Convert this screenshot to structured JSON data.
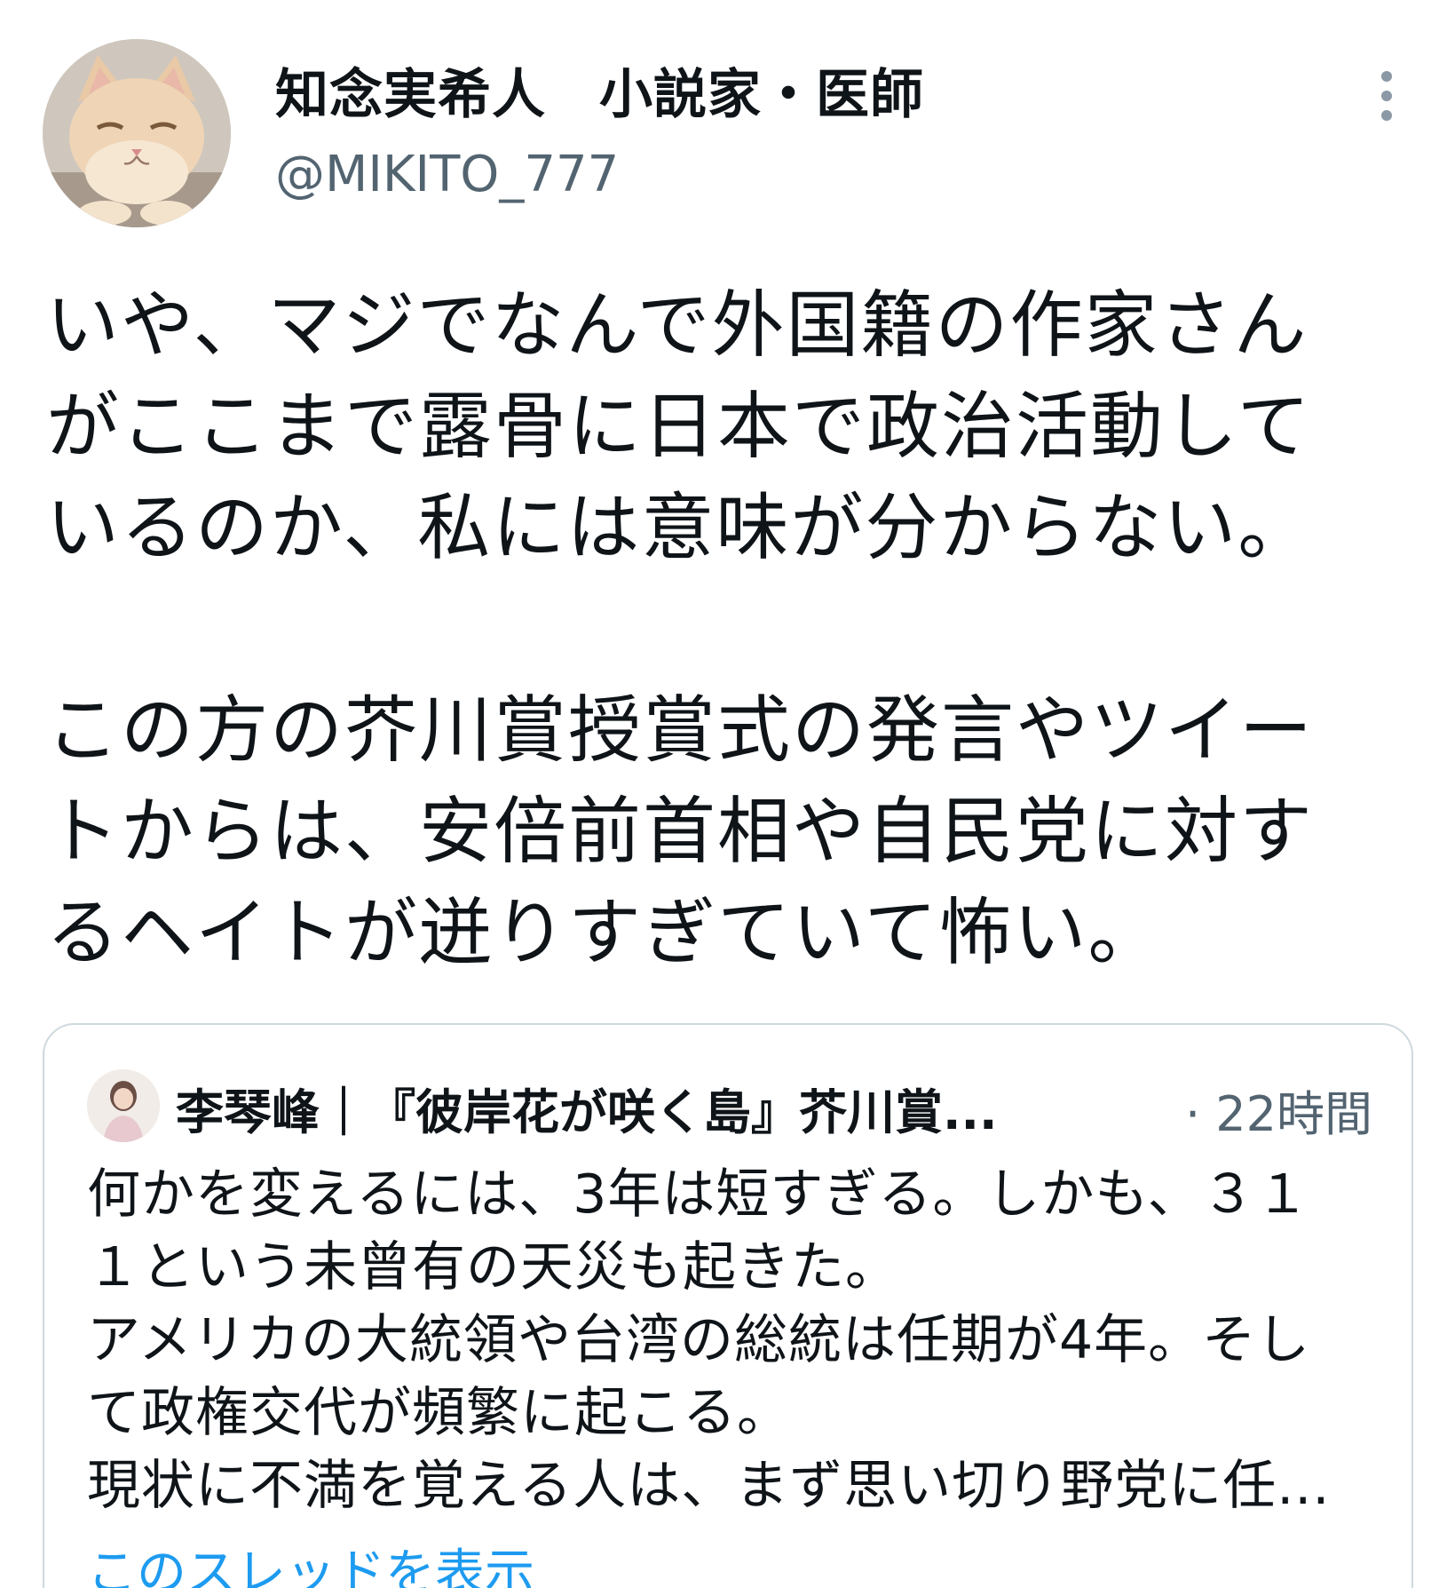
{
  "author": {
    "display_name": "知念実希人",
    "bio_tag": "小説家・医師",
    "handle": "@MIKITO_777",
    "avatar_icon": "cat-avatar-icon"
  },
  "header": {
    "more_icon": "more-vertical-icon",
    "more_color": "#8b98a5"
  },
  "tweet": {
    "lines": [
      "いや、マジでなんで外国籍の作家さん",
      "がここまで露骨に日本で政治活動して",
      "いるのか、私には意味が分からない。",
      "",
      "この方の芥川賞授賞式の発言やツイー",
      "トからは、安倍前首相や自民党に対す",
      "るヘイトが迸りすぎていて怖い。"
    ]
  },
  "quote": {
    "author": "李琴峰｜『彼岸花が咲く島』芥川賞...",
    "time": "· 22時間",
    "lines": [
      "何かを変えるには、3年は短すぎる。しかも、３１",
      "１という未曾有の天災も起きた。",
      "アメリカの大統領や台湾の総統は任期が4年。そし",
      "て政権交代が頻繁に起こる。",
      "現状に不満を覚える人は、まず思い切り野党に任..."
    ],
    "show_thread": "このスレッドを表示",
    "link_color": "#1d9bf0",
    "border_color": "#cfd9de"
  }
}
